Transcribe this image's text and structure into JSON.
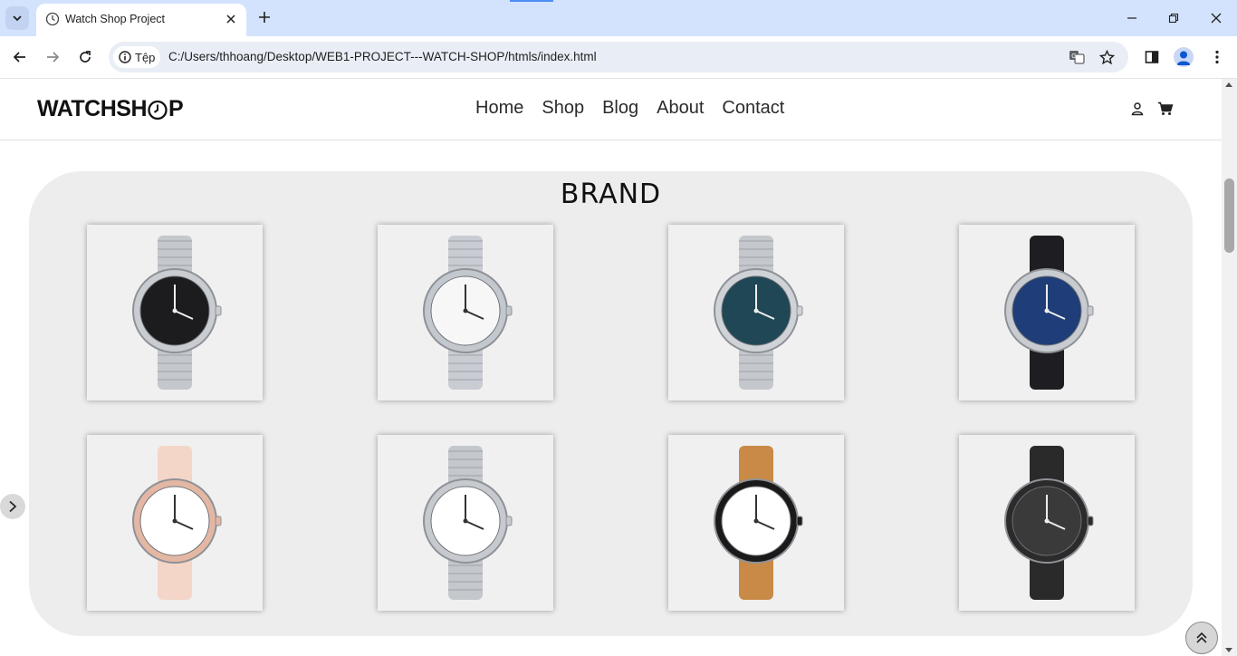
{
  "browser": {
    "tab_title": "Watch Shop Project",
    "site_chip_label": "Tệp",
    "url": "C:/Users/thhoang/Desktop/WEB1-PROJECT---WATCH-SHOP/htmls/index.html"
  },
  "site": {
    "logo_text_left": "WATCHSH",
    "logo_text_right": "P",
    "nav": [
      "Home",
      "Shop",
      "Blog",
      "About",
      "Contact"
    ]
  },
  "brand_section": {
    "title": "BRAND",
    "products": [
      {
        "strap": "steel",
        "dial": "#1c1c1f",
        "case": "#c9ccd0",
        "style": "black-dial-steel"
      },
      {
        "strap": "mesh-steel",
        "dial": "#f7f7f7",
        "case": "#c3c8cf",
        "style": "white-dial-steel"
      },
      {
        "strap": "steel",
        "dial": "#1f4756",
        "case": "#cfd2d6",
        "style": "open-heart-teal"
      },
      {
        "strap": "black-fabric",
        "dial": "#1f3d78",
        "case": "#c8cbd0",
        "style": "blue-chronograph"
      },
      {
        "strap": "pink-leather",
        "dial": "#ffffff",
        "case": "#e3b7a3",
        "style": "rose-gold-white"
      },
      {
        "strap": "steel",
        "dial": "#ffffff",
        "case": "#c6c9cd",
        "style": "roman-white-steel"
      },
      {
        "strap": "tan-leather",
        "dial": "#ffffff",
        "case": "#1a1a1a",
        "style": "black-case-chrono"
      },
      {
        "strap": "black-leather",
        "dial": "#3a3a3a",
        "case": "#2b2b2b",
        "style": "black-minimal"
      }
    ]
  }
}
